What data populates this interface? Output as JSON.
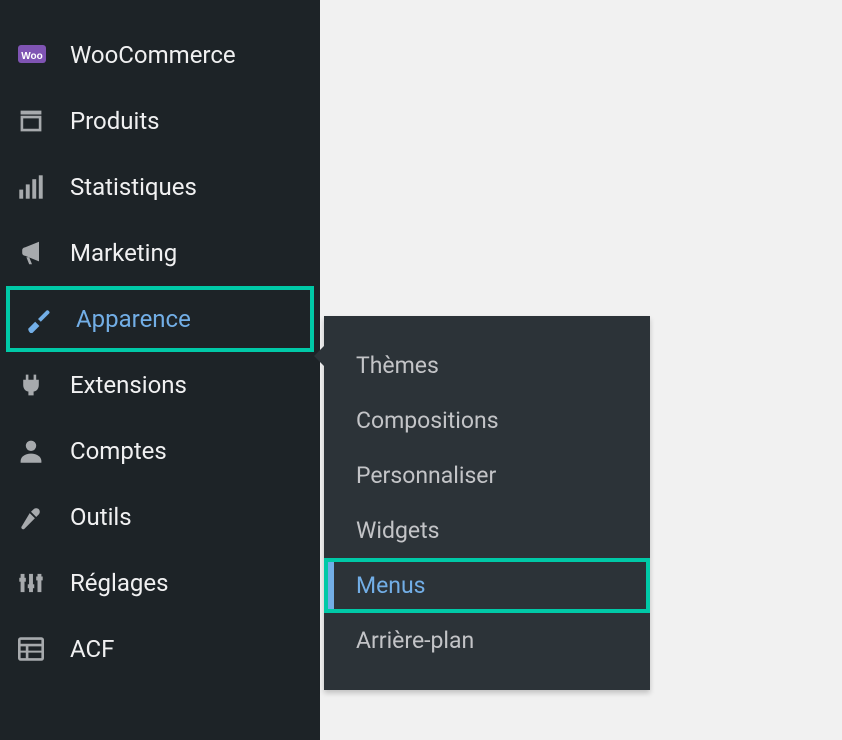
{
  "sidebar": {
    "items": [
      {
        "label": "WooCommerce",
        "icon": "woocommerce-icon"
      },
      {
        "label": "Produits",
        "icon": "products-icon"
      },
      {
        "label": "Statistiques",
        "icon": "statistics-icon"
      },
      {
        "label": "Marketing",
        "icon": "marketing-icon"
      },
      {
        "label": "Apparence",
        "icon": "appearance-icon",
        "highlighted": true
      },
      {
        "label": "Extensions",
        "icon": "plugins-icon"
      },
      {
        "label": "Comptes",
        "icon": "users-icon"
      },
      {
        "label": "Outils",
        "icon": "tools-icon"
      },
      {
        "label": "Réglages",
        "icon": "settings-icon"
      },
      {
        "label": "ACF",
        "icon": "acf-icon"
      }
    ]
  },
  "submenu": {
    "items": [
      {
        "label": "Thèmes"
      },
      {
        "label": "Compositions"
      },
      {
        "label": "Personnaliser"
      },
      {
        "label": "Widgets"
      },
      {
        "label": "Menus",
        "highlighted": true
      },
      {
        "label": "Arrière-plan"
      }
    ]
  },
  "colors": {
    "accent": "#72aee6",
    "highlight": "#00c9a7",
    "sidebar_bg": "#1d2327",
    "submenu_bg": "#2c3338"
  }
}
